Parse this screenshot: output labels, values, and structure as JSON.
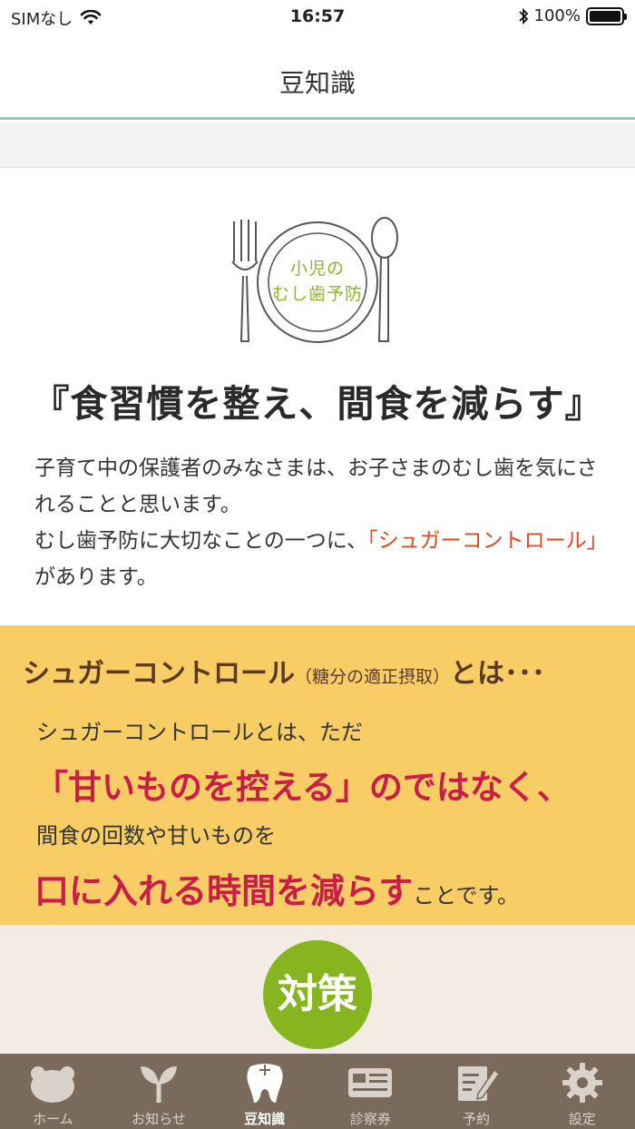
{
  "status_bar": {
    "carrier": "SIMなし",
    "time": "16:57",
    "battery": "100%",
    "battery_level": 1.0
  },
  "nav": {
    "title": "豆知識"
  },
  "article": {
    "plate_text_line1": "小児の",
    "plate_text_line2": "むし歯予防",
    "headline": "『食習慣を整え、間食を減らす』",
    "intro_part1": "子育て中の保護者のみなさまは、お子さまのむし歯を気にされることと思います。",
    "intro_part2": "むし歯予防に大切なことの一つに、",
    "intro_highlight": "「シュガーコントロール」",
    "intro_part3": "があります。",
    "highlight_color": "#e04a1f"
  },
  "sugar_box": {
    "title_main": "シュガーコントロール",
    "title_sub": "（糖分の適正摂取）",
    "title_tail": "とは･･･",
    "line1": "シュガーコントロールとは、ただ",
    "line2": "「甘いものを控える」のではなく、",
    "line3": "間食の回数や甘いものを",
    "line4_big": "口に入れる時間を減らす",
    "line4_small": "ことです。",
    "background": "#f9cd66",
    "accent": "#c81e47"
  },
  "countermeasure": {
    "label": "対策",
    "color": "#86b51f"
  },
  "tab_bar": {
    "background": "#7a6a5c",
    "tabs": [
      {
        "label": "ホーム",
        "icon": "bear-icon",
        "active": false
      },
      {
        "label": "お知らせ",
        "icon": "sprout-icon",
        "active": false
      },
      {
        "label": "豆知識",
        "icon": "tooth-icon",
        "active": true
      },
      {
        "label": "診察券",
        "icon": "card-icon",
        "active": false
      },
      {
        "label": "予約",
        "icon": "edit-icon",
        "active": false
      },
      {
        "label": "設定",
        "icon": "gear-icon",
        "active": false
      }
    ]
  }
}
